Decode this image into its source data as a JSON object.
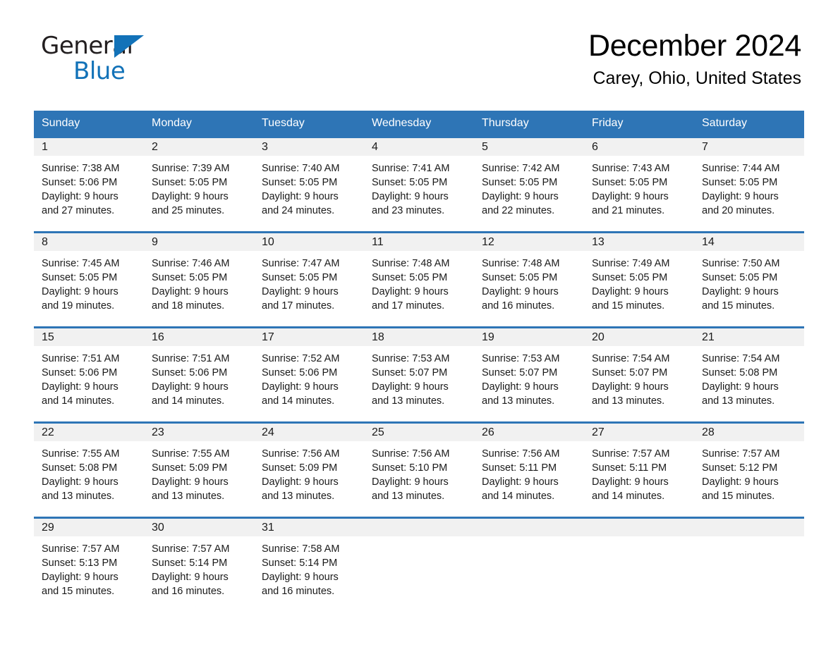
{
  "brand": {
    "name_part1": "General",
    "name_part2": "Blue",
    "triangle_color": "#1272b8"
  },
  "header": {
    "title": "December 2024",
    "location": "Carey, Ohio, United States",
    "accent_color": "#2e75b6",
    "band_color": "#f1f1f1"
  },
  "labels": {
    "sunrise_prefix": "Sunrise: ",
    "sunset_prefix": "Sunset: ",
    "daylight_prefix": "Daylight: "
  },
  "weekday_headers": [
    "Sunday",
    "Monday",
    "Tuesday",
    "Wednesday",
    "Thursday",
    "Friday",
    "Saturday"
  ],
  "weeks": [
    [
      {
        "day": "1",
        "sunrise": "Sunrise: 7:38 AM",
        "sunset": "Sunset: 5:06 PM",
        "daylight_line1": "Daylight: 9 hours",
        "daylight_line2": "and 27 minutes."
      },
      {
        "day": "2",
        "sunrise": "Sunrise: 7:39 AM",
        "sunset": "Sunset: 5:05 PM",
        "daylight_line1": "Daylight: 9 hours",
        "daylight_line2": "and 25 minutes."
      },
      {
        "day": "3",
        "sunrise": "Sunrise: 7:40 AM",
        "sunset": "Sunset: 5:05 PM",
        "daylight_line1": "Daylight: 9 hours",
        "daylight_line2": "and 24 minutes."
      },
      {
        "day": "4",
        "sunrise": "Sunrise: 7:41 AM",
        "sunset": "Sunset: 5:05 PM",
        "daylight_line1": "Daylight: 9 hours",
        "daylight_line2": "and 23 minutes."
      },
      {
        "day": "5",
        "sunrise": "Sunrise: 7:42 AM",
        "sunset": "Sunset: 5:05 PM",
        "daylight_line1": "Daylight: 9 hours",
        "daylight_line2": "and 22 minutes."
      },
      {
        "day": "6",
        "sunrise": "Sunrise: 7:43 AM",
        "sunset": "Sunset: 5:05 PM",
        "daylight_line1": "Daylight: 9 hours",
        "daylight_line2": "and 21 minutes."
      },
      {
        "day": "7",
        "sunrise": "Sunrise: 7:44 AM",
        "sunset": "Sunset: 5:05 PM",
        "daylight_line1": "Daylight: 9 hours",
        "daylight_line2": "and 20 minutes."
      }
    ],
    [
      {
        "day": "8",
        "sunrise": "Sunrise: 7:45 AM",
        "sunset": "Sunset: 5:05 PM",
        "daylight_line1": "Daylight: 9 hours",
        "daylight_line2": "and 19 minutes."
      },
      {
        "day": "9",
        "sunrise": "Sunrise: 7:46 AM",
        "sunset": "Sunset: 5:05 PM",
        "daylight_line1": "Daylight: 9 hours",
        "daylight_line2": "and 18 minutes."
      },
      {
        "day": "10",
        "sunrise": "Sunrise: 7:47 AM",
        "sunset": "Sunset: 5:05 PM",
        "daylight_line1": "Daylight: 9 hours",
        "daylight_line2": "and 17 minutes."
      },
      {
        "day": "11",
        "sunrise": "Sunrise: 7:48 AM",
        "sunset": "Sunset: 5:05 PM",
        "daylight_line1": "Daylight: 9 hours",
        "daylight_line2": "and 17 minutes."
      },
      {
        "day": "12",
        "sunrise": "Sunrise: 7:48 AM",
        "sunset": "Sunset: 5:05 PM",
        "daylight_line1": "Daylight: 9 hours",
        "daylight_line2": "and 16 minutes."
      },
      {
        "day": "13",
        "sunrise": "Sunrise: 7:49 AM",
        "sunset": "Sunset: 5:05 PM",
        "daylight_line1": "Daylight: 9 hours",
        "daylight_line2": "and 15 minutes."
      },
      {
        "day": "14",
        "sunrise": "Sunrise: 7:50 AM",
        "sunset": "Sunset: 5:05 PM",
        "daylight_line1": "Daylight: 9 hours",
        "daylight_line2": "and 15 minutes."
      }
    ],
    [
      {
        "day": "15",
        "sunrise": "Sunrise: 7:51 AM",
        "sunset": "Sunset: 5:06 PM",
        "daylight_line1": "Daylight: 9 hours",
        "daylight_line2": "and 14 minutes."
      },
      {
        "day": "16",
        "sunrise": "Sunrise: 7:51 AM",
        "sunset": "Sunset: 5:06 PM",
        "daylight_line1": "Daylight: 9 hours",
        "daylight_line2": "and 14 minutes."
      },
      {
        "day": "17",
        "sunrise": "Sunrise: 7:52 AM",
        "sunset": "Sunset: 5:06 PM",
        "daylight_line1": "Daylight: 9 hours",
        "daylight_line2": "and 14 minutes."
      },
      {
        "day": "18",
        "sunrise": "Sunrise: 7:53 AM",
        "sunset": "Sunset: 5:07 PM",
        "daylight_line1": "Daylight: 9 hours",
        "daylight_line2": "and 13 minutes."
      },
      {
        "day": "19",
        "sunrise": "Sunrise: 7:53 AM",
        "sunset": "Sunset: 5:07 PM",
        "daylight_line1": "Daylight: 9 hours",
        "daylight_line2": "and 13 minutes."
      },
      {
        "day": "20",
        "sunrise": "Sunrise: 7:54 AM",
        "sunset": "Sunset: 5:07 PM",
        "daylight_line1": "Daylight: 9 hours",
        "daylight_line2": "and 13 minutes."
      },
      {
        "day": "21",
        "sunrise": "Sunrise: 7:54 AM",
        "sunset": "Sunset: 5:08 PM",
        "daylight_line1": "Daylight: 9 hours",
        "daylight_line2": "and 13 minutes."
      }
    ],
    [
      {
        "day": "22",
        "sunrise": "Sunrise: 7:55 AM",
        "sunset": "Sunset: 5:08 PM",
        "daylight_line1": "Daylight: 9 hours",
        "daylight_line2": "and 13 minutes."
      },
      {
        "day": "23",
        "sunrise": "Sunrise: 7:55 AM",
        "sunset": "Sunset: 5:09 PM",
        "daylight_line1": "Daylight: 9 hours",
        "daylight_line2": "and 13 minutes."
      },
      {
        "day": "24",
        "sunrise": "Sunrise: 7:56 AM",
        "sunset": "Sunset: 5:09 PM",
        "daylight_line1": "Daylight: 9 hours",
        "daylight_line2": "and 13 minutes."
      },
      {
        "day": "25",
        "sunrise": "Sunrise: 7:56 AM",
        "sunset": "Sunset: 5:10 PM",
        "daylight_line1": "Daylight: 9 hours",
        "daylight_line2": "and 13 minutes."
      },
      {
        "day": "26",
        "sunrise": "Sunrise: 7:56 AM",
        "sunset": "Sunset: 5:11 PM",
        "daylight_line1": "Daylight: 9 hours",
        "daylight_line2": "and 14 minutes."
      },
      {
        "day": "27",
        "sunrise": "Sunrise: 7:57 AM",
        "sunset": "Sunset: 5:11 PM",
        "daylight_line1": "Daylight: 9 hours",
        "daylight_line2": "and 14 minutes."
      },
      {
        "day": "28",
        "sunrise": "Sunrise: 7:57 AM",
        "sunset": "Sunset: 5:12 PM",
        "daylight_line1": "Daylight: 9 hours",
        "daylight_line2": "and 15 minutes."
      }
    ],
    [
      {
        "day": "29",
        "sunrise": "Sunrise: 7:57 AM",
        "sunset": "Sunset: 5:13 PM",
        "daylight_line1": "Daylight: 9 hours",
        "daylight_line2": "and 15 minutes."
      },
      {
        "day": "30",
        "sunrise": "Sunrise: 7:57 AM",
        "sunset": "Sunset: 5:14 PM",
        "daylight_line1": "Daylight: 9 hours",
        "daylight_line2": "and 16 minutes."
      },
      {
        "day": "31",
        "sunrise": "Sunrise: 7:58 AM",
        "sunset": "Sunset: 5:14 PM",
        "daylight_line1": "Daylight: 9 hours",
        "daylight_line2": "and 16 minutes."
      },
      {
        "day": "",
        "sunrise": "",
        "sunset": "",
        "daylight_line1": "",
        "daylight_line2": ""
      },
      {
        "day": "",
        "sunrise": "",
        "sunset": "",
        "daylight_line1": "",
        "daylight_line2": ""
      },
      {
        "day": "",
        "sunrise": "",
        "sunset": "",
        "daylight_line1": "",
        "daylight_line2": ""
      },
      {
        "day": "",
        "sunrise": "",
        "sunset": "",
        "daylight_line1": "",
        "daylight_line2": ""
      }
    ]
  ]
}
